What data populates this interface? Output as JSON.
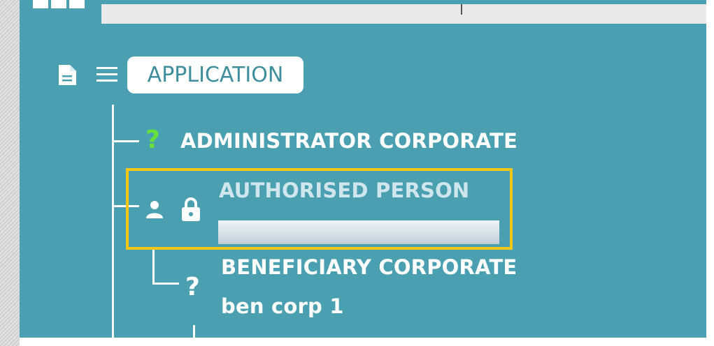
{
  "colors": {
    "panel_background": "#4aa0b0",
    "highlight_border": "#f5c518",
    "unknown_status": "#66e03a",
    "muted_label": "#cfe6ec"
  },
  "icons": {
    "document": "document-icon",
    "list": "list-icon",
    "question": "question-icon",
    "person": "person-icon",
    "lock": "lock-icon"
  },
  "tree": {
    "root": {
      "label": "APPLICATION"
    },
    "nodes": [
      {
        "role": "ADMINISTRATOR CORPORATE",
        "status_icon": "question-icon",
        "status_color": "#66e03a"
      },
      {
        "role": "AUTHORISED PERSON",
        "status_icon": "person-icon",
        "locked": true,
        "selected": true,
        "name_redacted": true
      },
      {
        "role": "BENEFICIARY CORPORATE",
        "name": "ben corp 1",
        "status_icon": "question-icon"
      }
    ]
  }
}
